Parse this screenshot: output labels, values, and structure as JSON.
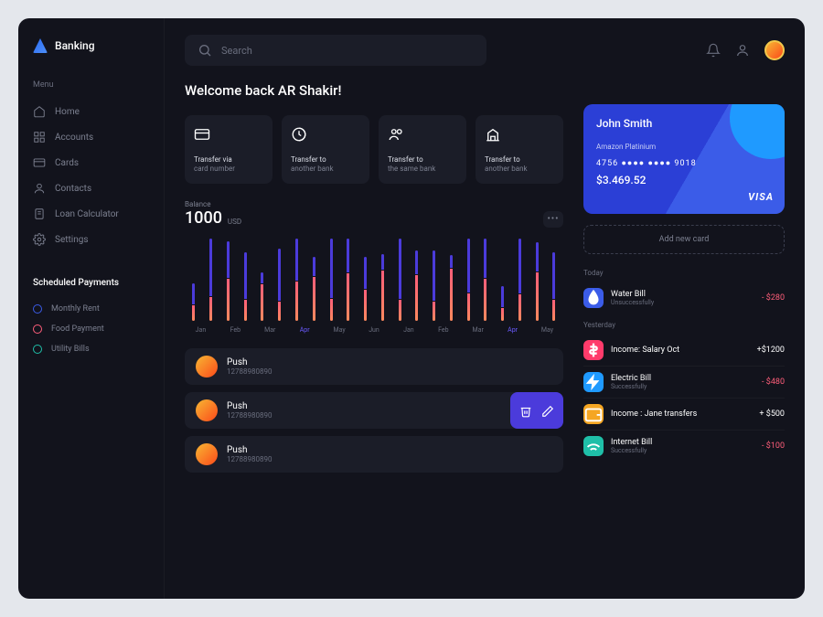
{
  "app_name": "Banking",
  "sidebar": {
    "menu_label": "Menu",
    "items": [
      {
        "label": "Home"
      },
      {
        "label": "Accounts"
      },
      {
        "label": "Cards"
      },
      {
        "label": "Contacts"
      },
      {
        "label": "Loan Calculator"
      },
      {
        "label": "Settings"
      }
    ],
    "scheduled_label": "Scheduled Payments",
    "scheduled": [
      {
        "label": "Monthly Rent",
        "color": "#3b5ce8"
      },
      {
        "label": "Food Payment",
        "color": "#ff5e7a"
      },
      {
        "label": "Utility Bills",
        "color": "#1fbfa8"
      }
    ]
  },
  "search_placeholder": "Search",
  "welcome": "Welcome back AR Shakir!",
  "action_cards": [
    {
      "line1": "Transfer via",
      "line2": "card number"
    },
    {
      "line1": "Transfer to",
      "line2": "another bank"
    },
    {
      "line1": "Transfer to",
      "line2": "the same bank"
    },
    {
      "line1": "Transfer to",
      "line2": "another bank"
    }
  ],
  "balance": {
    "label": "Balance",
    "value": "1000",
    "currency": "USD"
  },
  "chart_data": {
    "type": "bar",
    "categories": [
      "Jan",
      "Feb",
      "Mar",
      "Apr",
      "May",
      "Jun",
      "Jan",
      "Feb",
      "Mar",
      "Apr",
      "May"
    ],
    "highlight_indices": [
      3,
      9
    ],
    "series": [
      {
        "name": "series-a",
        "values": [
          20,
          60,
          35,
          45,
          10,
          50,
          55,
          18,
          62,
          40,
          30,
          15,
          58,
          22,
          48,
          12,
          52,
          38,
          20,
          60,
          28,
          45
        ]
      },
      {
        "name": "series-b",
        "values": [
          15,
          25,
          40,
          20,
          35,
          18,
          50,
          42,
          22,
          55,
          30,
          48,
          20,
          44,
          18,
          50,
          26,
          40,
          12,
          28,
          46,
          20
        ]
      }
    ],
    "ylim": [
      0,
      70
    ]
  },
  "contacts": [
    {
      "name": "Push",
      "number": "12788980890",
      "active": false
    },
    {
      "name": "Push",
      "number": "12788980890",
      "active": true
    },
    {
      "name": "Push",
      "number": "12788980890",
      "active": false
    }
  ],
  "credit_card": {
    "holder": "John Smith",
    "plan": "Amazon Platinium",
    "number": "4756  ●●●●  ●●●●  9018",
    "balance": "$3.469.52",
    "brand": "VISA"
  },
  "add_card_label": "Add new card",
  "transactions": {
    "today_label": "Today",
    "yesterday_label": "Yesterday",
    "today": [
      {
        "name": "Water Bill",
        "status": "Unsuccessfully",
        "amount": "- $280",
        "neg": true,
        "color": "#3b5ce8",
        "icon": "drop"
      }
    ],
    "yesterday": [
      {
        "name": "Income: Salary Oct",
        "status": "",
        "amount": "+$1200",
        "neg": false,
        "color": "#ff3b6b",
        "icon": "dollar"
      },
      {
        "name": "Electric Bill",
        "status": "Successfully",
        "amount": "- $480",
        "neg": true,
        "color": "#1f9aff",
        "icon": "bolt"
      },
      {
        "name": "Income : Jane transfers",
        "status": "",
        "amount": "+ $500",
        "neg": false,
        "color": "#f5a623",
        "icon": "wallet"
      },
      {
        "name": "Internet Bill",
        "status": "Successfully",
        "amount": "- $100",
        "neg": true,
        "color": "#1fbfa8",
        "icon": "wifi"
      }
    ]
  }
}
